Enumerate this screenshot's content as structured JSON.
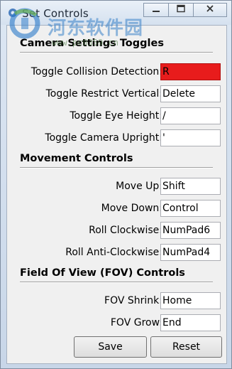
{
  "window": {
    "title": "Set Controls",
    "minimize_icon": "minimize-icon",
    "restore_icon": "restore-icon",
    "close_icon": "close-icon"
  },
  "watermark": {
    "text": "河东软件园",
    "url": "www.pc0359.cn"
  },
  "sections": {
    "camera": {
      "title": "Camera Settings Toggles",
      "rows": [
        {
          "label": "Toggle Collision Detection:",
          "value": "R",
          "highlight": "#e81c1c"
        },
        {
          "label": "Toggle Restrict Vertical:",
          "value": "Delete"
        },
        {
          "label": "Toggle Eye Height:",
          "value": "/"
        },
        {
          "label": "Toggle Camera Upright:",
          "value": "'"
        }
      ]
    },
    "movement": {
      "title": "Movement Controls",
      "rows": [
        {
          "label": "Move Up:",
          "value": "Shift"
        },
        {
          "label": "Move Down:",
          "value": "Control"
        },
        {
          "label": "Roll Clockwise:",
          "value": "NumPad6"
        },
        {
          "label": "Roll Anti-Clockwise:",
          "value": "NumPad4"
        }
      ]
    },
    "fov": {
      "title": "Field Of View (FOV) Controls",
      "rows": [
        {
          "label": "FOV Shrink:",
          "value": "Home"
        },
        {
          "label": "FOV Grow:",
          "value": "End"
        }
      ]
    }
  },
  "buttons": {
    "save": "Save",
    "reset": "Reset"
  }
}
